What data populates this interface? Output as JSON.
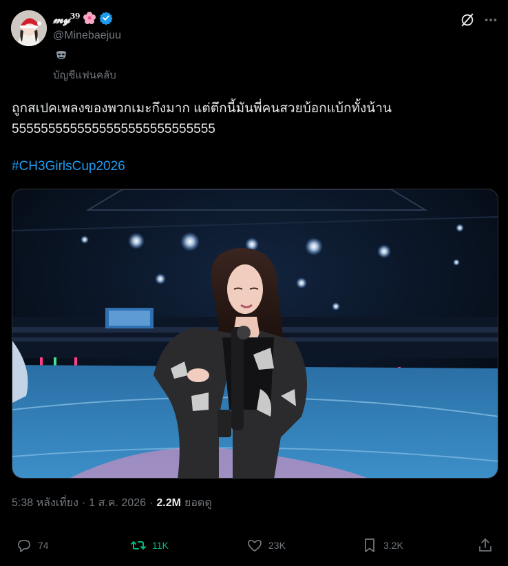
{
  "author": {
    "display_name": "𝓶𝔂",
    "display_sup": "39",
    "handle": "@Minebaejuu",
    "fan_label": "บัญชีแฟนคลับ"
  },
  "tweet": {
    "line1": "ถูกสเปคเพลงของพวกเมะกึงมาก แต่ตึกนี้มันพี่คนสวยบ้อกแบ้กทั้งน้าน",
    "line2": "5555555555555555555555555555",
    "hashtag": "#CH3GirlsCup2026"
  },
  "meta": {
    "time": "5:38 หลังเที่ยง",
    "sep1": "·",
    "date": "1 ส.ค. 2026",
    "sep2": "·",
    "views_count": "2.2M",
    "views_label": "ยอดดู"
  },
  "actions": {
    "replies": "74",
    "reposts": "11K",
    "likes": "23K",
    "bookmarks": "3.2K"
  },
  "colors": {
    "accent_blue": "#1d9bf0",
    "repost_green": "#00ba7c",
    "muted": "#71767b"
  }
}
